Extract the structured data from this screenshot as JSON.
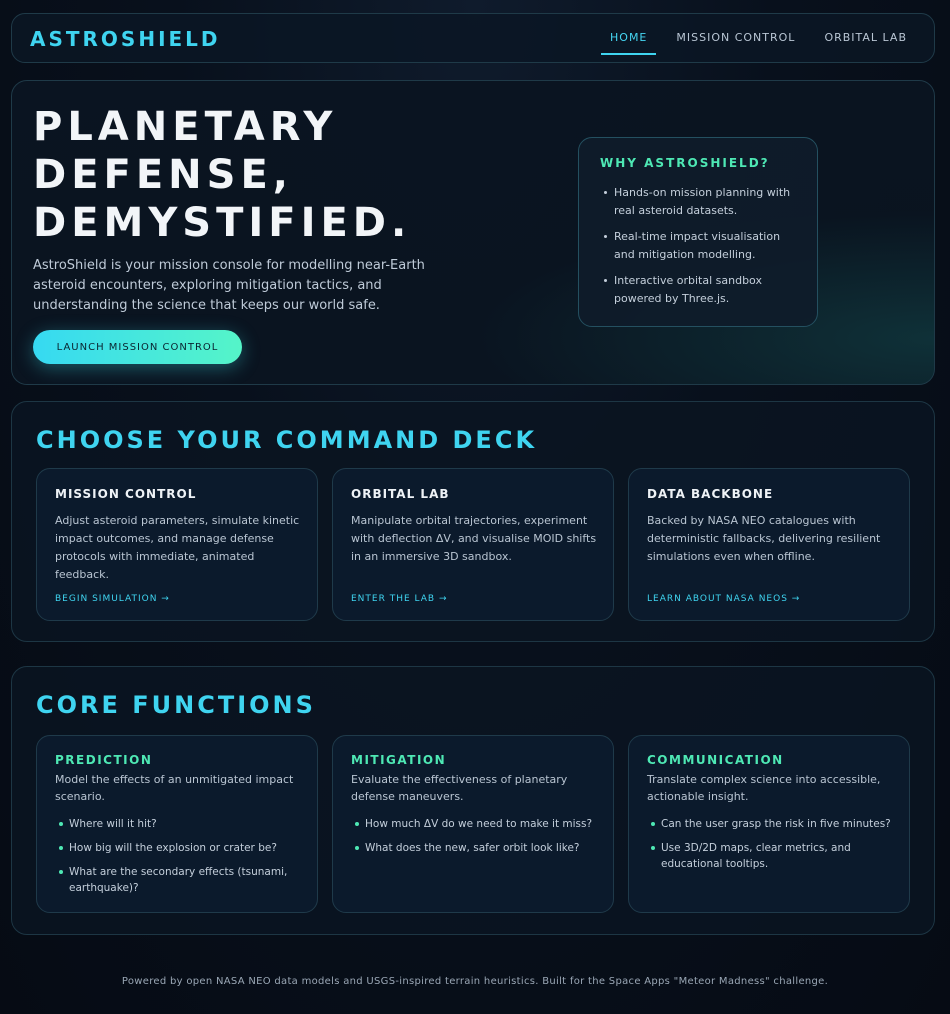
{
  "header": {
    "brand": "ASTROSHIELD",
    "nav": [
      {
        "label": "HOME",
        "active": true
      },
      {
        "label": "MISSION CONTROL",
        "active": false
      },
      {
        "label": "ORBITAL LAB",
        "active": false
      }
    ]
  },
  "hero": {
    "title_lines": [
      "PLANETARY",
      "DEFENSE,",
      "DEMYSTIFIED."
    ],
    "description": "AstroShield is your mission console for modelling near-Earth asteroid encounters, exploring mitigation tactics, and understanding the science that keeps our world safe.",
    "cta_label": "LAUNCH MISSION CONTROL",
    "why": {
      "title": "WHY ASTROSHIELD?",
      "items": [
        "Hands-on mission planning with real asteroid datasets.",
        "Real-time impact visualisation and mitigation modelling.",
        "Interactive orbital sandbox powered by Three.js."
      ]
    }
  },
  "deck": {
    "title": "CHOOSE YOUR COMMAND DECK",
    "cards": [
      {
        "title": "MISSION CONTROL",
        "body": "Adjust asteroid parameters, simulate kinetic impact outcomes, and manage defense protocols with immediate, animated feedback.",
        "link": "BEGIN SIMULATION →"
      },
      {
        "title": "ORBITAL LAB",
        "body": "Manipulate orbital trajectories, experiment with deflection ΔV, and visualise MOID shifts in an immersive 3D sandbox.",
        "link": "ENTER THE LAB →"
      },
      {
        "title": "DATA BACKBONE",
        "body": "Backed by NASA NEO catalogues with deterministic fallbacks, delivering resilient simulations even when offline.",
        "link": "LEARN ABOUT NASA NEOS →"
      }
    ]
  },
  "core": {
    "title": "CORE FUNCTIONS",
    "cards": [
      {
        "title": "PREDICTION",
        "body": "Model the effects of an unmitigated impact scenario.",
        "items": [
          "Where will it hit?",
          "How big will the explosion or crater be?",
          "What are the secondary effects (tsunami, earthquake)?"
        ]
      },
      {
        "title": "MITIGATION",
        "body": "Evaluate the effectiveness of planetary defense maneuvers.",
        "items": [
          "How much ΔV do we need to make it miss?",
          "What does the new, safer orbit look like?"
        ]
      },
      {
        "title": "COMMUNICATION",
        "body": "Translate complex science into accessible, actionable insight.",
        "items": [
          "Can the user grasp the risk in five minutes?",
          "Use 3D/2D maps, clear metrics, and educational tooltips."
        ]
      }
    ]
  },
  "footer": {
    "text": "Powered by open NASA NEO data models and USGS-inspired terrain heuristics. Built for the Space Apps \"Meteor Madness\" challenge."
  },
  "colors": {
    "accent_cyan": "#3fd4f0",
    "accent_green": "#4ee8b4",
    "background": "#08101c"
  }
}
